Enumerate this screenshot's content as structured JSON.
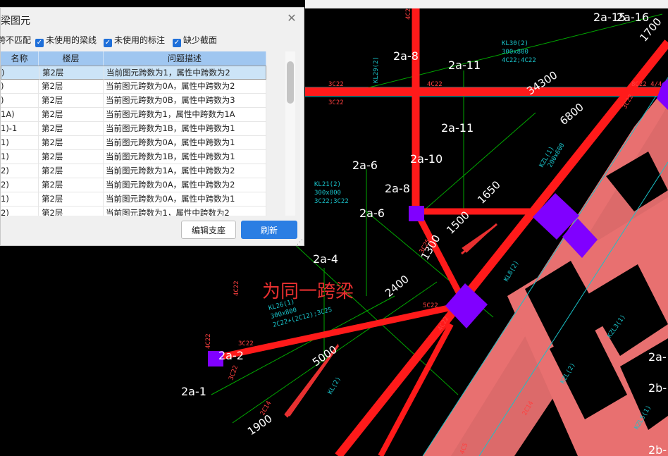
{
  "dialog": {
    "title": "梁图元",
    "close": "✕",
    "filters": [
      {
        "label": "跨不匹配",
        "checked": true
      },
      {
        "label": "未使用的梁线",
        "checked": true
      },
      {
        "label": "未使用的标注",
        "checked": true
      },
      {
        "label": "缺少截面",
        "checked": true
      }
    ],
    "columns": [
      "名称",
      "楼层",
      "问题描述"
    ],
    "rows": [
      {
        "name": ")",
        "floor": "第2层",
        "desc": "当前图元跨数为1，属性中跨数为2"
      },
      {
        "name": ")",
        "floor": "第2层",
        "desc": "当前图元跨数为0A，属性中跨数为2"
      },
      {
        "name": ")",
        "floor": "第2层",
        "desc": "当前图元跨数为0B，属性中跨数为3"
      },
      {
        "name": "1A)",
        "floor": "第2层",
        "desc": "当前图元跨数为1，属性中跨数为1A"
      },
      {
        "name": "1)-1",
        "floor": "第2层",
        "desc": "当前图元跨数为1B，属性中跨数为1"
      },
      {
        "name": "1)",
        "floor": "第2层",
        "desc": "当前图元跨数为0A，属性中跨数为1"
      },
      {
        "name": "1)",
        "floor": "第2层",
        "desc": "当前图元跨数为1B，属性中跨数为1"
      },
      {
        "name": "2)",
        "floor": "第2层",
        "desc": "当前图元跨数为1A，属性中跨数为2"
      },
      {
        "name": "2)",
        "floor": "第2层",
        "desc": "当前图元跨数为0A，属性中跨数为2"
      },
      {
        "name": "1)",
        "floor": "第2层",
        "desc": "当前图元跨数为0A，属性中跨数为1"
      },
      {
        "name": "2)",
        "floor": "第2层",
        "desc": "当前图元跨数为1，属性中跨数为2"
      }
    ],
    "buttons": {
      "edit": "编辑支座",
      "refresh": "刷新"
    }
  },
  "drawing": {
    "annotation": "为同一跨梁",
    "axis_labels": [
      "2a-8",
      "2a-11",
      "2a-11",
      "2a-6",
      "2a-10",
      "2a-8",
      "2a-6",
      "2a-4",
      "2a-2",
      "2a-1",
      "2a-15",
      "2a-16",
      "2a-",
      "2b-",
      "2b-"
    ],
    "dimensions": [
      "34300",
      "6800",
      "1650",
      "1500",
      "1300",
      "2400",
      "5000",
      "1900",
      "1700"
    ],
    "beam_labels": [
      "KL29(2)",
      "KL30(2)",
      "KL21(2)",
      "KL26(1)",
      "KL(2)",
      "KZL(1)",
      "KZL3(1)",
      "KZL(2)",
      "KL8(2)",
      "KZL5(1)"
    ],
    "beam_specs": [
      "300x800",
      "4C22;4C22",
      "3C22;3C22",
      "2C22+(2C12);3C25",
      "200x600"
    ],
    "rebar_labels": [
      "3C22",
      "3C22",
      "4C22",
      "8C22 4/4",
      "3C22",
      "5C22",
      "4C22",
      "4C22",
      "3C22",
      "3C22",
      "4C22",
      "2C14",
      "4C5",
      "4C22",
      "3C25",
      "2C14"
    ],
    "colors": {
      "beam": "#ff1a1a",
      "column": "#8000ff",
      "slab": "#e87070",
      "dim": "#00b000",
      "text": "#ffffff",
      "annotation": "#e83030",
      "spec": "#19c2c9"
    }
  }
}
